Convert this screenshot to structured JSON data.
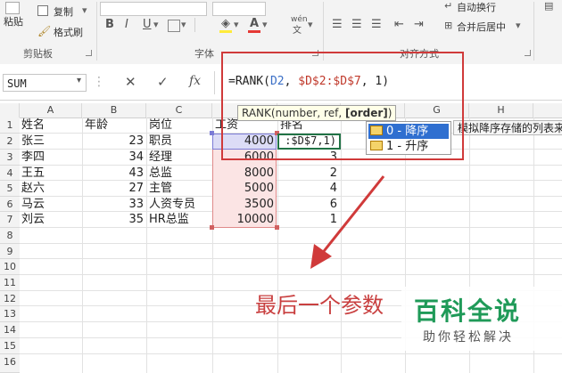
{
  "ribbon": {
    "paste_label": "粘贴",
    "copy_label": "复制",
    "format_painter_label": "格式刷",
    "clipboard_group": "剪贴板",
    "font_group": "字体",
    "alignment_group": "对齐方式",
    "wrap_text_label": "自动换行",
    "merge_center_label": "合并后居中",
    "bold_label": "B",
    "italic_label": "I",
    "underline_label": "U",
    "phonetic_label": "wén"
  },
  "formula_bar": {
    "name_box": "SUM",
    "cancel_symbol": "✕",
    "enter_symbol": "✓",
    "fx_label": "fx",
    "formula_prefix": "=RANK(",
    "formula_ref1": "D2",
    "formula_sep1": ", ",
    "formula_ref2": "$D$2:$D$7",
    "formula_suffix": ", 1)"
  },
  "tooltip": {
    "prefix": "RANK(number, ref, ",
    "current_arg": "[order]",
    "suffix": ")"
  },
  "autocomplete": {
    "items": [
      {
        "label": "0 - 降序"
      },
      {
        "label": "1 - 升序"
      }
    ],
    "hint": "模拟降序存储的列表来"
  },
  "grid": {
    "columns": [
      "A",
      "B",
      "C",
      "D",
      "E",
      "F",
      "G",
      "H"
    ],
    "rows": [
      "1",
      "2",
      "3",
      "4",
      "5",
      "6",
      "7",
      "8",
      "9",
      "10",
      "11",
      "12",
      "13",
      "14",
      "15",
      "16"
    ],
    "header_row": {
      "a": "姓名",
      "b": "年龄",
      "c": "岗位",
      "d": "工资",
      "e": "排名"
    },
    "data_rows": [
      {
        "name": "张三",
        "age": "23",
        "post": "职员",
        "salary": "4000",
        "rank": ":$D$7,1)"
      },
      {
        "name": "李四",
        "age": "34",
        "post": "经理",
        "salary": "6000",
        "rank": "3"
      },
      {
        "name": "王五",
        "age": "43",
        "post": "总监",
        "salary": "8000",
        "rank": "2"
      },
      {
        "name": "赵六",
        "age": "27",
        "post": "主管",
        "salary": "5000",
        "rank": "4"
      },
      {
        "name": "马云",
        "age": "33",
        "post": "人资专员",
        "salary": "3500",
        "rank": "6"
      },
      {
        "name": "刘云",
        "age": "35",
        "post": "HR总监",
        "salary": "10000",
        "rank": "1"
      }
    ]
  },
  "annotation": "最后一个参数",
  "watermark": {
    "main": "百科全说",
    "sub": "助你轻松解决"
  },
  "colors": {
    "accent_red": "#d03a3a",
    "excel_green": "#217346",
    "logo_green": "#1f9a58"
  }
}
